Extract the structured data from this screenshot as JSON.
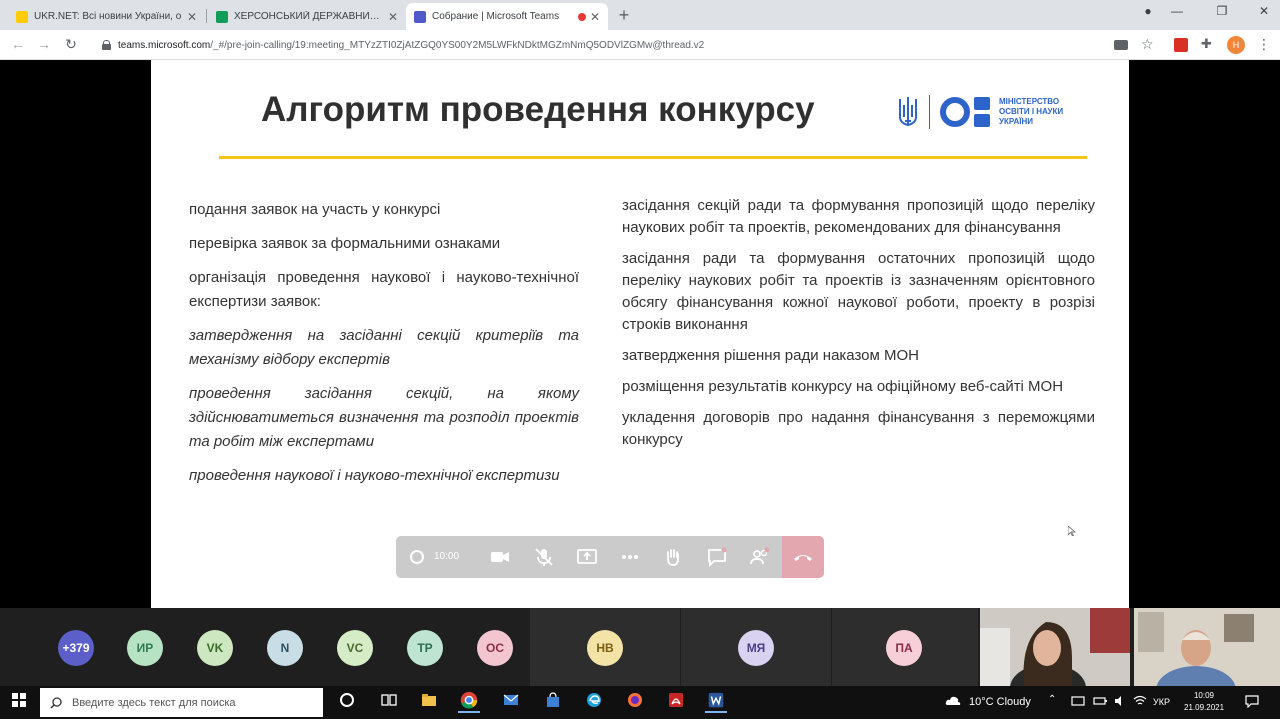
{
  "browser": {
    "tabs": [
      {
        "title": "UKR.NET: Всі новини України, о",
        "favicon_color": "#ffcc00",
        "active": false
      },
      {
        "title": "ХЕРСОНСЬКИЙ ДЕРЖАВНИЙ А",
        "favicon_color": "#0f9d58",
        "active": false
      },
      {
        "title": "Собрание | Microsoft Teams",
        "favicon_color": "#5059c9",
        "active": true
      }
    ],
    "address_domain": "teams.microsoft.com",
    "address_path": "/_#/pre-join-calling/19:meeting_MTYzZTI0ZjAtZGQ0YS00Y2M5LWFkNDktMGZmNmQ5ODVlZGMw@thread.v2",
    "profile_initial": "Н"
  },
  "slide": {
    "title": "Алгоритм проведення конкурсу",
    "logo_text": [
      "МІНІСТЕРСТВО",
      "ОСВІТИ І НАУКИ",
      "УКРАЇНИ"
    ],
    "left_items": [
      {
        "text": "подання заявок на участь у конкурсі",
        "italic": false
      },
      {
        "text": "перевірка заявок за формальними ознаками",
        "italic": false
      },
      {
        "text": "організація проведення наукової і науково-технічної експертизи заявок:",
        "italic": false
      },
      {
        "text": "затвердження на засіданні секцій критеріїв та механізму відбору експертів",
        "italic": true
      },
      {
        "text": "проведення засідання секцій, на якому здійснюватиметься визначення та розподіл проектів та робіт між експертами",
        "italic": true
      },
      {
        "text": "проведення наукової і науково-технічної експертизи",
        "italic": true
      }
    ],
    "right_items": [
      {
        "text": "засідання секцій ради та формування пропозицій щодо переліку наукових робіт та проектів, рекомендованих для фінансування"
      },
      {
        "text": "засідання ради та формування остаточних пропозицій щодо переліку наукових робіт та проектів із зазначенням орієнтовного обсягу фінансування кожної наукової роботи, проекту в розрізі строків виконання"
      },
      {
        "text": "затвердження рішення ради наказом МОН"
      },
      {
        "text": "розміщення результатів конкурсу на офіційному веб-сайті МОН"
      },
      {
        "text": "укладення договорів про надання фінансування з переможцями конкурсу"
      }
    ]
  },
  "call": {
    "timer": "10:00",
    "participants": [
      {
        "initials": "+379",
        "bg": "#5b5fc7",
        "fg": "#ffffff"
      },
      {
        "initials": "ИР",
        "bg": "#b7e3c4",
        "fg": "#2e7d4f"
      },
      {
        "initials": "VK",
        "bg": "#cde8c0",
        "fg": "#3d6b2a"
      },
      {
        "initials": "N",
        "bg": "#c9dde6",
        "fg": "#2f4f5f"
      },
      {
        "initials": "VC",
        "bg": "#d6ecc6",
        "fg": "#4a6b2f"
      },
      {
        "initials": "TP",
        "bg": "#bfe4d2",
        "fg": "#2b6e52"
      },
      {
        "initials": "ОС",
        "bg": "#f2c5cf",
        "fg": "#8a3048"
      },
      {
        "initials": "НВ",
        "bg": "#f4e3a6",
        "fg": "#7a5e12"
      },
      {
        "initials": "МЯ",
        "bg": "#d9d2f0",
        "fg": "#4b3f8a"
      },
      {
        "initials": "ПА",
        "bg": "#f6cfd8",
        "fg": "#8a2f47"
      }
    ]
  },
  "taskbar": {
    "search_placeholder": "Введите здесь текст для поиска",
    "weather": "10°C Cloudy",
    "language": "УКР",
    "time": "10:09",
    "date": "21.09.2021"
  }
}
